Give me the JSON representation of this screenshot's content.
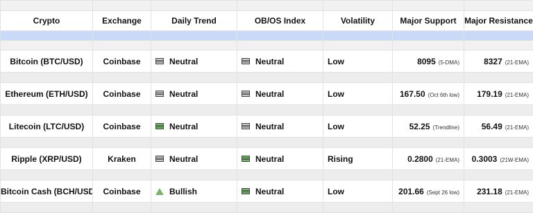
{
  "headers": {
    "crypto": "Crypto",
    "exchange": "Exchange",
    "daily_trend": "Daily Trend",
    "obos": "OB/OS Index",
    "volatility": "Volatility",
    "support": "Major Support",
    "resistance": "Major Resistance"
  },
  "icons": {
    "neutral_gray": "neutral-gray-icon",
    "neutral_green": "neutral-green-icon",
    "bullish": "bullish-triangle-icon"
  },
  "colors": {
    "blue_band": "#c9daf8",
    "neutral_gray": "#c8c8c8",
    "neutral_green": "#6cbf5e",
    "bullish": "#7cb36a"
  },
  "rows": [
    {
      "crypto": "Bitcoin (BTC/USD)",
      "exchange": "Coinbase",
      "trend": "Neutral",
      "trend_icon": "neutral_gray",
      "obos": "Neutral",
      "obos_icon": "neutral_gray",
      "volatility": "Low",
      "support": "8095",
      "support_note": "(5-DMA)",
      "resistance": "8327",
      "resistance_note": "(21-EMA)"
    },
    {
      "crypto": "Ethereum (ETH/USD)",
      "exchange": "Coinbase",
      "trend": "Neutral",
      "trend_icon": "neutral_gray",
      "obos": "Neutral",
      "obos_icon": "neutral_gray",
      "volatility": "Low",
      "support": "167.50",
      "support_note": "(Oct 6th low)",
      "resistance": "179.19",
      "resistance_note": "(21-EMA)"
    },
    {
      "crypto": "Litecoin (LTC/USD)",
      "exchange": "Coinbase",
      "trend": "Neutral",
      "trend_icon": "neutral_green",
      "obos": "Neutral",
      "obos_icon": "neutral_gray",
      "volatility": "Low",
      "support": "52.25",
      "support_note": "(Trendline)",
      "resistance": "56.49",
      "resistance_note": "(21-EMA)"
    },
    {
      "crypto": "Ripple (XRP/USD)",
      "exchange": "Kraken",
      "trend": "Neutral",
      "trend_icon": "neutral_gray",
      "obos": "Neutral",
      "obos_icon": "neutral_green",
      "volatility": "Rising",
      "support": "0.2800",
      "support_note": "(21-EMA)",
      "resistance": "0.3003",
      "resistance_note": "(21W-EMA)"
    },
    {
      "crypto": "Bitcoin Cash (BCH/USD)",
      "exchange": "Coinbase",
      "trend": "Bullish",
      "trend_icon": "bullish",
      "obos": "Neutral",
      "obos_icon": "neutral_green",
      "volatility": "Low",
      "support": "201.66",
      "support_note": "(Sept 26 low)",
      "resistance": "231.18",
      "resistance_note": "(21-EMA)"
    }
  ]
}
